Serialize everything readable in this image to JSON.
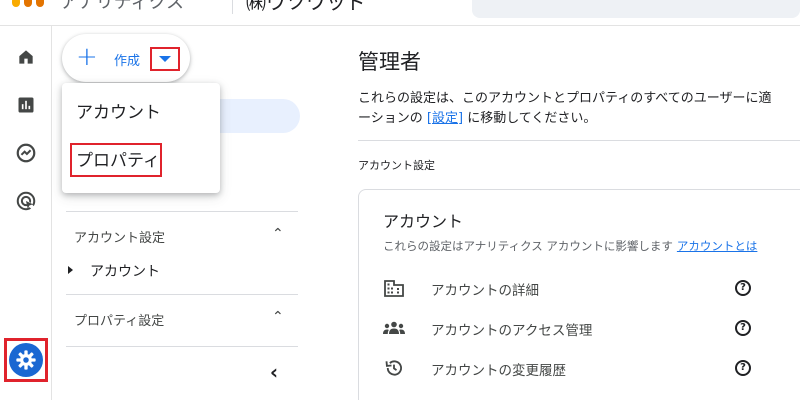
{
  "topbar": {
    "product_name": "アナリティクス",
    "account_name": "㈱ウツワッド"
  },
  "rail": {
    "items": [
      {
        "icon": "home-icon"
      },
      {
        "icon": "reports-icon"
      },
      {
        "icon": "explore-icon"
      },
      {
        "icon": "advertising-icon"
      }
    ],
    "admin_icon": "gear-icon",
    "accent": "#1a67d2",
    "highlight_color": "#e0232c"
  },
  "create": {
    "plus": "+",
    "label": "作成"
  },
  "menu": {
    "items": [
      "アカウント",
      "プロパティ"
    ]
  },
  "nav": {
    "account_settings": "アカウント設定",
    "account_item": "アカウント",
    "property_settings": "プロパティ設定",
    "chevron_up": "⌃",
    "collapse": "‹"
  },
  "main": {
    "title": "管理者",
    "desc_line1": "これらの設定は、このアカウントとプロパティのすべてのユーザーに適",
    "desc_line2_prefix": "ーションの",
    "desc_line2_link": "[設定]",
    "desc_line2_suffix": "に移動してください。",
    "section_label": "アカウント設定",
    "card": {
      "title": "アカウント",
      "desc": "これらの設定はアナリティクス アカウントに影響します",
      "desc_link": "アカウントとは",
      "rows": [
        {
          "icon": "building-icon",
          "label": "アカウントの詳細",
          "help": "?"
        },
        {
          "icon": "people-icon",
          "label": "アカウントのアクセス管理",
          "help": "?"
        },
        {
          "icon": "history-icon",
          "label": "アカウントの変更履歴",
          "help": "?"
        }
      ]
    }
  }
}
